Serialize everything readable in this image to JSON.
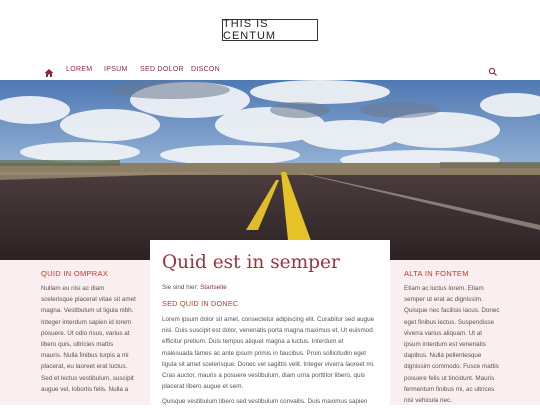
{
  "header": {
    "logo": "THIS IS CENTUM"
  },
  "nav": {
    "items": [
      {
        "label": "LOREM"
      },
      {
        "label": "IPSUM"
      },
      {
        "label": "SED DOLOR"
      },
      {
        "label": "DISCON"
      }
    ]
  },
  "left": {
    "heading": "QUID IN OMPRAX",
    "lines": [
      "Nullam eu nisi ac diam",
      "scelerisque placerat vitae sit amet",
      "magna. Vestibulum ut ligula nibh.",
      "Integer interdum sapien id lorem",
      "posuere. Ut odio risus, varius at",
      "libero quis, ultricies mattis",
      "mauris. Nulla finibus turpis a mi",
      "placerat, eu laoreet erat luctus.",
      "Sed et lectus vestibulum, suscipit",
      "augue vel, lobortis felis. Nulla a"
    ]
  },
  "main": {
    "title": "Quid est in semper",
    "breadcrumb_prefix": "Sie sind hier:",
    "breadcrumb_link": "Startseite",
    "subheading": "SED QUID IN DONEC",
    "lines": [
      "Lorem ipsum dolor sit amet, consectetur adipiscing elit. Curabitur sed augue",
      "nisi. Duis suscipit est dolor, venenatis porta magna maximus et. Ut euismod",
      "efficitur pretium. Duis tempus aliquet magna a luctus. Interdum et",
      "malesuada fames ac ante ipsum primis in faucibus. Proin sollicitudin eget",
      "ligula sit amet scelerisque. Donec vel sagittis velit. Integer viverra laoreet mi.",
      "Cras auctor, mauris a posuere vestibulum, diam urna porttitor libero, quis",
      "placerat libero augue et sem.",
      "",
      "Quisque vestibulum libero sed vestibulum convallis. Duis maximus sapien"
    ]
  },
  "right": {
    "heading": "ALTA IN FONTEM",
    "lines": [
      "Etiam ac luctus lorem. Etiam",
      "semper ut erat ac dignissim.",
      "Quisque nec facilisis lacus. Donec",
      "eget finibus lectus. Suspendisse",
      "viverra varius aliquam. Ut at",
      "ipsum interdum est venenatis",
      "dapibus. Nulla pellentesque",
      "dignissim commodo. Fusce mattis",
      "posuere felis ut tincidunt. Mauris",
      "fermentum finibus mi, ac ultrices",
      "nisi vehicula nec."
    ]
  },
  "colors": {
    "accent": "#a0303f",
    "panel": "#fbeef0"
  },
  "icons": {
    "home": "home-icon",
    "search": "search-icon"
  }
}
